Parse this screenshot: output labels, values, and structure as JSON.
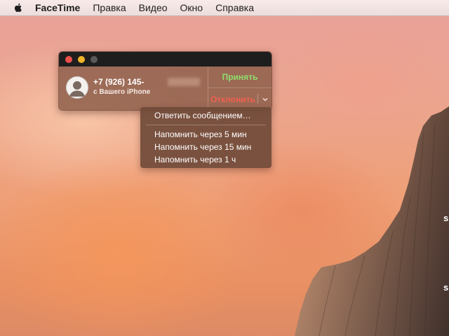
{
  "menubar": {
    "apple_icon": "apple-logo-icon",
    "items": [
      "FaceTime",
      "Правка",
      "Видео",
      "Окно",
      "Справка"
    ]
  },
  "call": {
    "caller_number": "+7 (926) 145-",
    "caller_source": "с Вашего iPhone",
    "accept_label": "Принять",
    "decline_label": "Отклонить",
    "decline_options_icon": "chevron-down-icon",
    "accept_color": "#8ee06e",
    "decline_color": "#f0604e"
  },
  "dropdown": {
    "reply_label": "Ответить сообщением…",
    "remind_items": [
      "Напомнить через 5 мин",
      "Напомнить через 15 мин",
      "Напомнить через 1 ч"
    ]
  },
  "desktop": {
    "edge_text": "s"
  }
}
